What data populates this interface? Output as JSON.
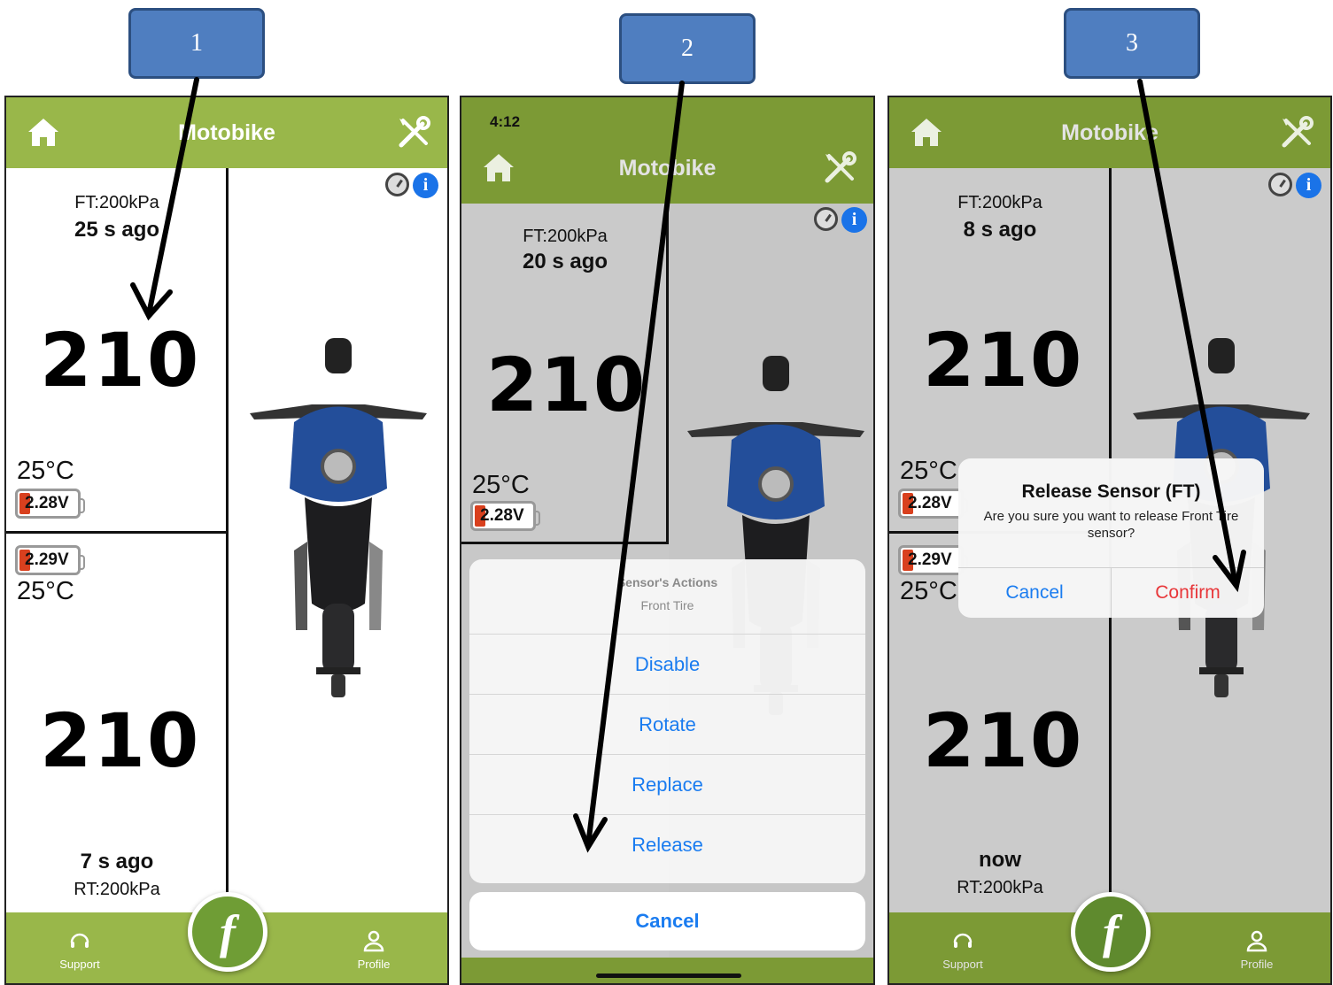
{
  "steps": [
    "1",
    "2",
    "3"
  ],
  "app": {
    "title": "Motobike",
    "info_glyph": "i"
  },
  "colors": {
    "green_bar": "#99b74a",
    "fab_green": "#6f9d35",
    "ios_blue": "#1a7cf0",
    "destructive_red": "#e8373a",
    "battery_low": "#d9401e"
  },
  "tabs": {
    "support": "Support",
    "profile": "Profile",
    "fab_glyph": "f"
  },
  "screen1": {
    "front": {
      "label": "FT:200kPa",
      "ago": "25 s ago",
      "pressure": "210",
      "temp": "25°C",
      "voltage": "2.28V"
    },
    "rear": {
      "voltage": "2.29V",
      "temp": "25°C",
      "pressure": "210",
      "ago": "7 s ago",
      "label": "RT:200kPa"
    }
  },
  "screen2": {
    "time": "4:12",
    "front": {
      "label": "FT:200kPa",
      "ago": "20 s ago",
      "pressure": "210",
      "temp": "25°C",
      "voltage": "2.28V"
    },
    "sheet": {
      "title": "Sensor's Actions",
      "message": "Front Tire",
      "actions": [
        "Disable",
        "Rotate",
        "Replace",
        "Release"
      ],
      "cancel": "Cancel"
    }
  },
  "screen3": {
    "front": {
      "label": "FT:200kPa",
      "ago": "8 s ago",
      "pressure": "210",
      "temp": "25°C",
      "voltage": "2.28V"
    },
    "rear": {
      "voltage": "2.29V",
      "temp": "25°C",
      "pressure": "210",
      "ago": "now",
      "label": "RT:200kPa"
    },
    "alert": {
      "title": "Release Sensor (FT)",
      "message": "Are you sure you want to release Front Tire sensor?",
      "cancel": "Cancel",
      "confirm": "Confirm"
    }
  }
}
